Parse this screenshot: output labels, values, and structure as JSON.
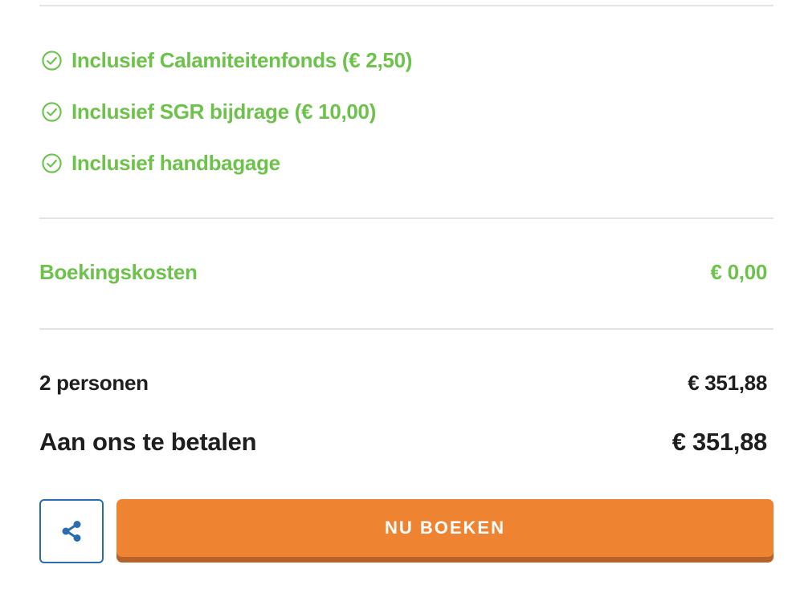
{
  "inclusions": [
    {
      "label": "Inclusief Calamiteitenfonds (€ 2,50)",
      "icon": "check-circle-icon"
    },
    {
      "label": "Inclusief SGR bijdrage (€ 10,00)",
      "icon": "check-circle-icon"
    },
    {
      "label": "Inclusief handbagage",
      "icon": "check-circle-icon"
    }
  ],
  "fees": {
    "label": "Boekingskosten",
    "amount": "€ 0,00"
  },
  "summary": {
    "persons_label": "2 personen",
    "persons_amount": "€ 351,88",
    "total_label": "Aan ons te betalen",
    "total_amount": "€ 351,88"
  },
  "actions": {
    "share_icon": "share-icon",
    "book_label": "NU BOEKEN"
  },
  "colors": {
    "green": "#6cc24a",
    "orange": "#ee8432",
    "blue": "#2b6cb0",
    "text": "#1e1e1e"
  }
}
